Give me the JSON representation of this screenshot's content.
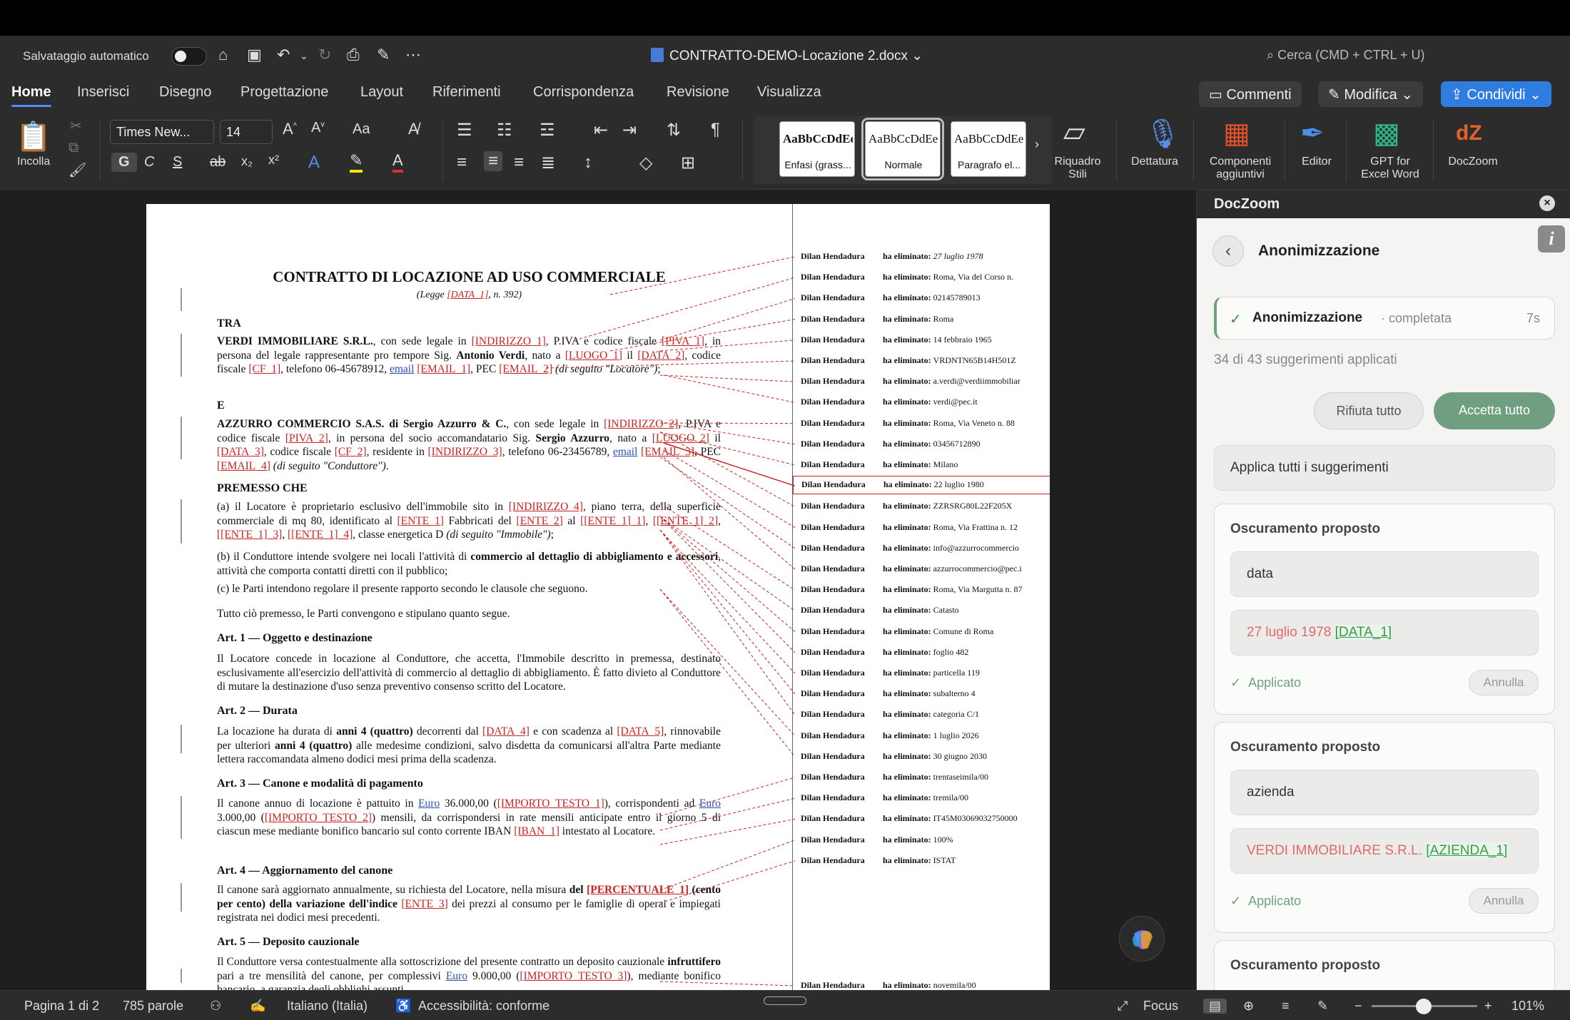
{
  "titlebar": {
    "autosave": "Salvataggio automatico",
    "doc_title": "CONTRATTO-DEMO-Locazione 2.docx",
    "search": "Cerca (CMD + CTRL + U)"
  },
  "tabs": [
    "Home",
    "Inserisci",
    "Disegno",
    "Progettazione",
    "Layout",
    "Riferimenti",
    "Corrispondenza",
    "Revisione",
    "Visualizza"
  ],
  "actions": {
    "comments": "Commenti",
    "edit": "Modifica",
    "share": "Condividi"
  },
  "ribbon": {
    "paste": "Incolla",
    "font": "Times New...",
    "size": "14",
    "fmt_bold": "G",
    "fmt_italic": "C",
    "fmt_under": "S",
    "styles": [
      {
        "preview": "AaBbCcDdEe",
        "name": "Enfasi (grass..."
      },
      {
        "preview": "AaBbCcDdEe",
        "name": "Normale"
      },
      {
        "preview": "AaBbCcDdEe",
        "name": "Paragrafo el..."
      }
    ],
    "tools": [
      {
        "label": "Riquadro\nStili"
      },
      {
        "label": "Dettatura"
      },
      {
        "label": "Componenti\naggiuntivi"
      },
      {
        "label": "Editor"
      },
      {
        "label": "GPT for\nExcel Word"
      },
      {
        "label": "DocZoom"
      }
    ]
  },
  "doc": {
    "title": "CONTRATTO DI LOCAZIONE AD USO COMMERCIALE",
    "tra": "TRA",
    "e": "E",
    "premesso": "PREMESSO CHE",
    "art1": "Art. 1 — Oggetto e destinazione",
    "art2": "Art. 2 — Durata",
    "art3": "Art. 3 — Canone e modalità di pagamento",
    "art4": "Art. 4 — Aggiornamento del canone",
    "art5": "Art. 5 — Deposito cauzionale",
    "tutto": "Tutto ciò premesso, le Parti convengono e stipulano quanto segue.",
    "p_c": "(c) le Parti intendono regolare il presente rapporto secondo le clausole che seguono."
  },
  "comments": {
    "author": "Dilan Hendadura",
    "label": "ha eliminato:",
    "items": [
      "27 luglio 1978",
      "Roma, Via del Corso n.",
      "02145789013",
      "Roma",
      "14 febbraio 1965",
      "VRDNTN65B14H501Z",
      "a.verdi@verdiimmobiliar",
      "verdi@pec.it",
      "Roma, Via Veneto n. 88",
      "03456712890",
      "Milano",
      "22 luglio 1980",
      "ZZRSRG80L22F205X",
      "Roma, Via Frattina n. 12",
      "info@azzurrocommercio",
      "azzurrocommercio@pec.i",
      "Roma, Via Margutta n. 87",
      "Catasto",
      "Comune di Roma",
      "foglio 482",
      "particella 119",
      "subalterno 4",
      "categoria C/1",
      "1 luglio 2026",
      "30 giugno 2030",
      "trentaseimila/00",
      "tremila/00",
      "IT45M03069032750000",
      "100%",
      "ISTAT"
    ],
    "last": "novemila/00"
  },
  "pane": {
    "header": "DocZoom",
    "title": "Anonimizzazione",
    "info": "i",
    "status_title": "Anonimizzazione",
    "status_state": "· completata",
    "status_time": "7s",
    "summary": "34 di 43 suggerimenti applicati",
    "reject": "Rifiuta tutto",
    "accept": "Accetta tutto",
    "apply_all": "Applica tutti i suggerimenti",
    "cards": [
      {
        "heading": "Oscuramento proposto",
        "kind": "data",
        "original": "27 luglio 1978",
        "replacement": "[DATA_1]",
        "applied": "Applicato",
        "undo": "Annulla"
      },
      {
        "heading": "Oscuramento proposto",
        "kind": "azienda",
        "original": "VERDI IMMOBILIARE S.R.L.",
        "replacement": "[AZIENDA_1]",
        "applied": "Applicato",
        "undo": "Annulla"
      },
      {
        "heading": "Oscuramento proposto"
      }
    ]
  },
  "statusbar": {
    "page": "Pagina 1 di 2",
    "words": "785 parole",
    "lang": "Italiano (Italia)",
    "access": "Accessibilità: conforme",
    "focus": "Focus",
    "zoom": "101%"
  }
}
